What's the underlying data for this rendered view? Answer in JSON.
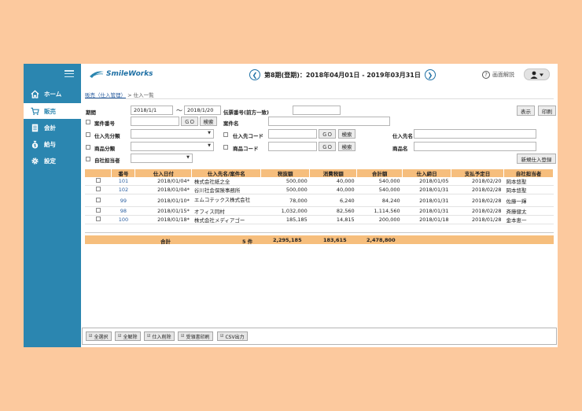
{
  "sidebar": {
    "items": [
      {
        "label": "ホーム",
        "icon": "home-icon"
      },
      {
        "label": "販売",
        "icon": "cart-icon"
      },
      {
        "label": "会計",
        "icon": "ledger-icon"
      },
      {
        "label": "給与",
        "icon": "money-bag-icon"
      },
      {
        "label": "設定",
        "icon": "gear-icon"
      }
    ]
  },
  "header": {
    "logo": "SmileWorks",
    "period": "第8期(登期)：2018年04月01日 - 2019年03月31日",
    "help": "画面解説"
  },
  "breadcrumb": {
    "parent": "販売（仕入管理）",
    "current": "> 仕入一覧"
  },
  "search": {
    "period_label": "期間",
    "date_from": "2018/1/1",
    "tilde": "～",
    "date_to": "2018/1/20",
    "doc_no_label": "伝票番号(前方一致)",
    "case_no_label": "案件番号",
    "case_name_label": "案件名",
    "supplier_cat_label": "仕入先分類",
    "supplier_code_label": "仕入先コード",
    "supplier_name_label": "仕入先名",
    "product_cat_label": "商品分類",
    "product_code_label": "商品コード",
    "product_name_label": "商品名",
    "staff_label": "自社担当者",
    "go": "ＧＯ",
    "search_btn": "検索",
    "show_btn": "表示",
    "print_btn": "印刷",
    "new_btn": "新規仕入登録"
  },
  "table": {
    "headers": [
      "番号",
      "仕入日付",
      "仕入先名/案件名",
      "税抜額",
      "消費税額",
      "合計額",
      "仕入締日",
      "支払予定日",
      "自社担当者"
    ],
    "rows": [
      {
        "no": "101",
        "date": "2018/01/04*",
        "supplier": "株式会社紙之全",
        "net": "500,000",
        "tax": "40,000",
        "total": "540,000",
        "close": "2018/01/05",
        "pay": "2018/02/20",
        "staff": "岡本悠聖"
      },
      {
        "no": "102",
        "date": "2018/01/04*",
        "supplier": "谷川社会保険事務所",
        "net": "500,000",
        "tax": "40,000",
        "total": "540,000",
        "close": "2018/01/31",
        "pay": "2018/02/28",
        "staff": "岡本悠聖"
      },
      {
        "no": "99",
        "date": "2018/01/10*",
        "supplier": "エムコテックス株式会社",
        "net": "78,000",
        "tax": "6,240",
        "total": "84,240",
        "close": "2018/01/31",
        "pay": "2018/02/28",
        "staff": "佐藤一輝"
      },
      {
        "no": "98",
        "date": "2018/01/15*",
        "supplier": "オフィス同村",
        "net": "1,032,000",
        "tax": "82,560",
        "total": "1,114,560",
        "close": "2018/01/31",
        "pay": "2018/02/28",
        "staff": "斉藤健太"
      },
      {
        "no": "100",
        "date": "2018/01/18*",
        "supplier": "株式会社メディアゴー",
        "net": "185,185",
        "tax": "14,815",
        "total": "200,000",
        "close": "2018/01/18",
        "pay": "2018/01/28",
        "staff": "金本恵一"
      }
    ]
  },
  "totals": {
    "label": "合計",
    "count": "5 件",
    "net": "2,295,185",
    "tax": "183,615",
    "total": "2,478,800"
  },
  "footer": {
    "buttons": [
      {
        "label": "全選択"
      },
      {
        "label": "全解除"
      },
      {
        "label": "仕入削除"
      },
      {
        "label": "受領書印刷"
      },
      {
        "label": "CSV出力"
      }
    ]
  }
}
